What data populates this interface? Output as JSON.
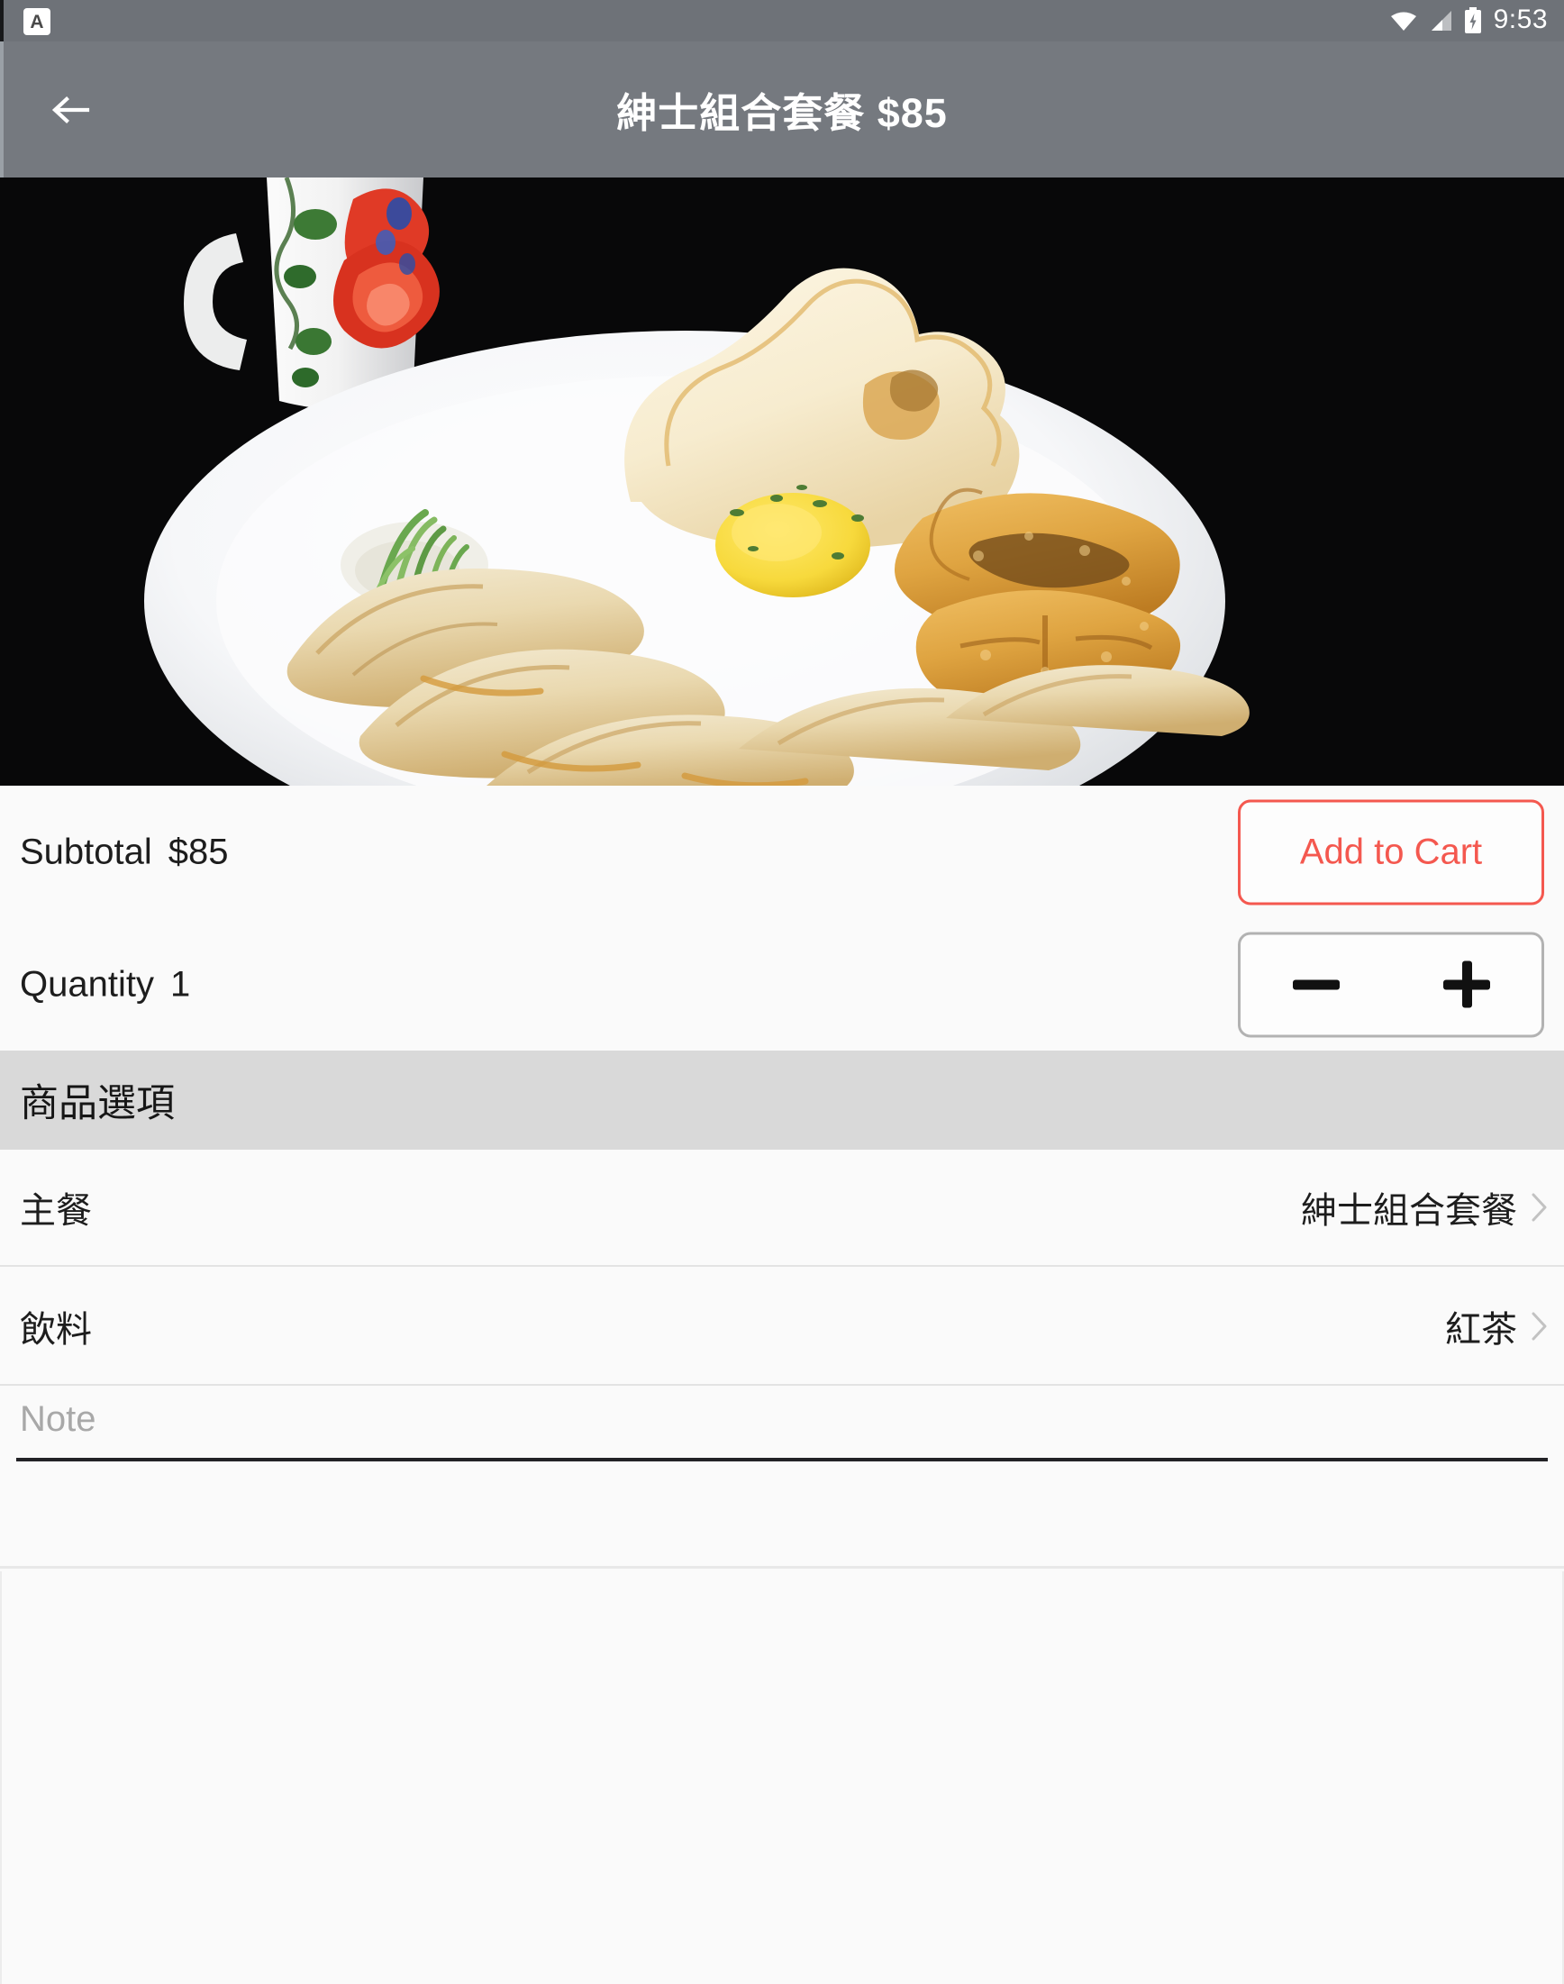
{
  "status_bar": {
    "notification_icon": "notification-letter-a-icon",
    "wifi_icon": "wifi-icon",
    "signal_icon": "cell-signal-icon",
    "battery_icon": "battery-charging-icon",
    "time": "9:53"
  },
  "toolbar": {
    "back_icon": "back-arrow-icon",
    "title": "紳士組合套餐 $85"
  },
  "hero": {
    "alt": "food-photo-fried-egg-dumplings-cutlet-plate"
  },
  "cart": {
    "subtotal_label": "Subtotal",
    "subtotal_value": "$85",
    "quantity_label": "Quantity",
    "quantity_value": "1",
    "add_to_cart_label": "Add to Cart",
    "decrement_icon": "minus-icon",
    "increment_icon": "plus-icon",
    "accent_color": "#f4584f"
  },
  "options": {
    "section_title": "商品選項",
    "rows": [
      {
        "name": "主餐",
        "value": "紳士組合套餐",
        "chevron_icon": "chevron-right-icon"
      },
      {
        "name": "飲料",
        "value": "紅茶",
        "chevron_icon": "chevron-right-icon"
      }
    ]
  },
  "note": {
    "placeholder": "Note",
    "value": ""
  }
}
